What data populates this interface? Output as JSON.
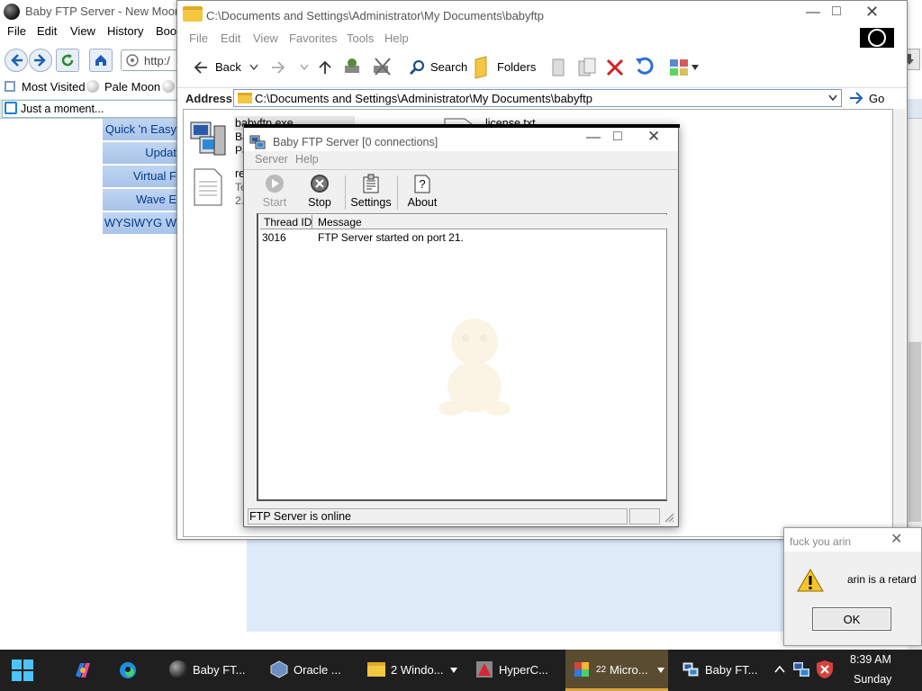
{
  "browser": {
    "title": "Baby FTP Server - New Moon",
    "menu": [
      "File",
      "Edit",
      "View",
      "History",
      "Bool"
    ],
    "url_partial": "http:/",
    "bookmarks": [
      "Most Visited",
      "Pale Moon"
    ],
    "tab_title": "Just a moment...",
    "side_links": [
      "Quick 'n Easy",
      "Updat",
      "Virtual F",
      "Wave E",
      "WYSIWYG W"
    ]
  },
  "explorer": {
    "title": "C:\\Documents and Settings\\Administrator\\My Documents\\babyftp",
    "menu": [
      "File",
      "Edit",
      "View",
      "Favorites",
      "Tools",
      "Help"
    ],
    "toolbar": {
      "back": "Back",
      "search": "Search",
      "folders": "Folders"
    },
    "address_label": "Address",
    "address_value": "C:\\Documents and Settings\\Administrator\\My Documents\\babyftp",
    "go_label": "Go",
    "files": [
      {
        "name": "babyftp.exe",
        "line2": "Ba",
        "line3": "Pa"
      },
      {
        "name": "re",
        "line2": "Te",
        "line3": "2."
      },
      {
        "name": "license.txt"
      }
    ]
  },
  "ftp": {
    "title": "Baby FTP Server [0 connections]",
    "menu": [
      "Server",
      "Help"
    ],
    "toolbar": {
      "start": "Start",
      "stop": "Stop",
      "settings": "Settings",
      "about": "About"
    },
    "columns": [
      "Thread ID",
      "Message"
    ],
    "rows": [
      {
        "thread_id": "3016",
        "message": "FTP Server started on port 21."
      }
    ],
    "status": "FTP Server is online"
  },
  "msgbox": {
    "title": "fuck you arin",
    "text": "arin is a retard",
    "ok": "OK"
  },
  "taskbar": {
    "items": [
      {
        "label": "Baby FT..."
      },
      {
        "label": "Oracle ..."
      },
      {
        "label": "2 Windo..."
      },
      {
        "label": "HyperC..."
      },
      {
        "label": "Micro...",
        "badge": "22"
      },
      {
        "label": "Baby FT..."
      }
    ],
    "time": "8:39 AM",
    "day": "Sunday"
  },
  "colors": {
    "taskbar": "#1f1f1f",
    "side_link_bg": "#bfd5f2",
    "side_link_text": "#003a8c",
    "folder_yellow": "#f4c742"
  }
}
